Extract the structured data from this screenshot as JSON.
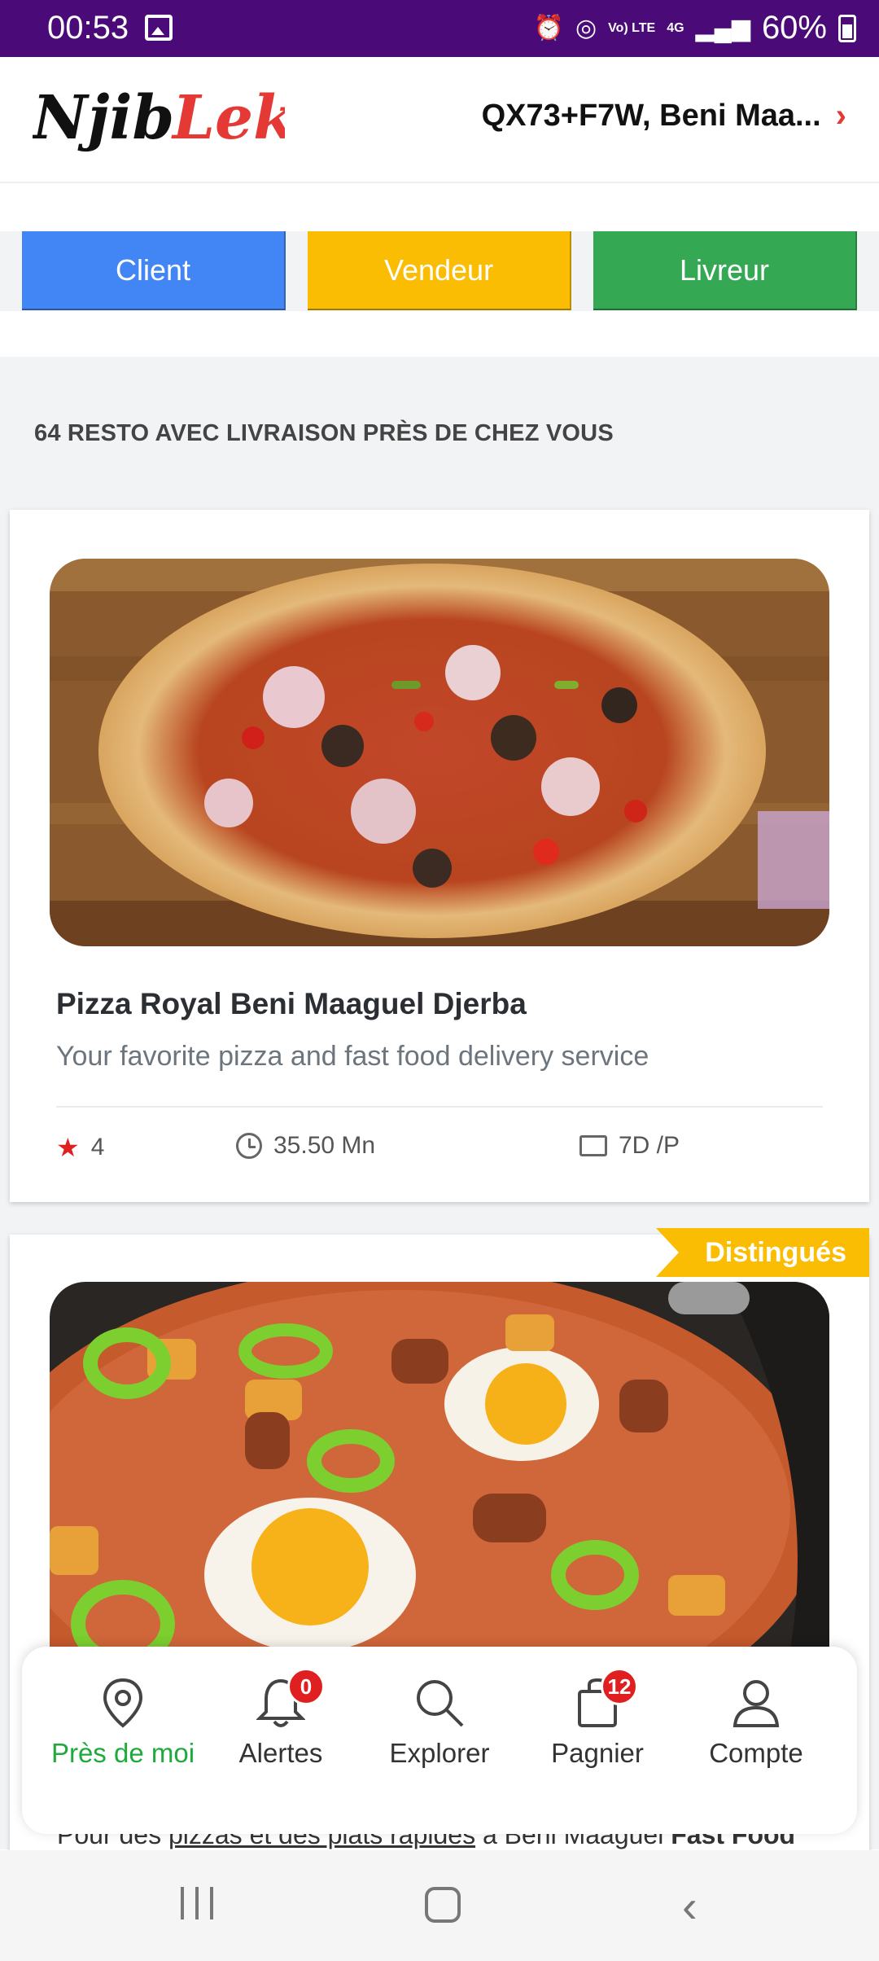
{
  "status_bar": {
    "time": "00:53",
    "network": "4G",
    "volte": "Vo) LTE",
    "battery": "60%"
  },
  "header": {
    "logo_part1": "Njib",
    "logo_part2": "Lek",
    "location": "QX73+F7W, Beni Maa...",
    "accent_color": "#e53935"
  },
  "roles": {
    "client": "Client",
    "vendeur": "Vendeur",
    "livreur": "Livreur",
    "colors": {
      "client": "#4285f4",
      "vendeur": "#fbbc04",
      "livreur": "#34a853"
    }
  },
  "listing": {
    "count_text": "64 RESTO AVEC LIVRAISON PRÈS DE CHEZ VOUS"
  },
  "restaurants": [
    {
      "name": "Pizza Royal Beni Maaguel Djerba",
      "description": "Your favorite pizza and fast food delivery service",
      "rating": "4",
      "delivery_fee": "35.50 Mn",
      "schedule": "7D /P",
      "image": "pizza-image"
    },
    {
      "badge": "Distingués",
      "image": "ojja-merguez-image",
      "peek_part1": "Pour des ",
      "peek_link": "pizzas et des plats rapides",
      "peek_part2": " à Beni Maaguel ",
      "peek_bold": "Fast Food"
    }
  ],
  "bottom_nav": {
    "items": [
      {
        "label": "Près de moi",
        "icon": "map-pin-icon",
        "active": true
      },
      {
        "label": "Alertes",
        "icon": "bell-icon",
        "badge": "0"
      },
      {
        "label": "Explorer",
        "icon": "search-icon"
      },
      {
        "label": "Pagnier",
        "icon": "shopping-bag-icon",
        "badge": "12"
      },
      {
        "label": "Compte",
        "icon": "user-icon"
      }
    ],
    "active_color": "#1eaa3c"
  }
}
